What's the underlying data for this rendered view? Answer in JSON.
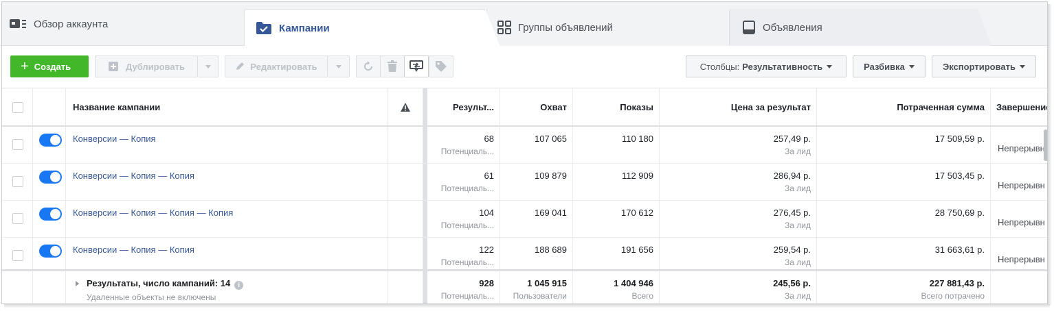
{
  "tabs": {
    "overview": "Обзор аккаунта",
    "campaigns": "Кампании",
    "adsets": "Группы объявлений",
    "ads": "Объявления"
  },
  "toolbar": {
    "create": "Создать",
    "duplicate": "Дублировать",
    "edit": "Редактировать",
    "columns_prefix": "Столбцы:",
    "columns_value": "Результативность",
    "breakdown": "Разбивка",
    "export": "Экспортировать"
  },
  "table": {
    "headers": {
      "name": "Название кампании",
      "results": "Результ...",
      "reach": "Охват",
      "impressions": "Показы",
      "cost": "Цена за результат",
      "spent": "Потраченная сумма",
      "end": "Завершение"
    },
    "rows": [
      {
        "name": "Конверсии — Копия",
        "results": "68",
        "results_sub": "Потенциаль...",
        "reach": "107 065",
        "impressions": "110 180",
        "cost": "257,49 р.",
        "cost_sub": "За лид",
        "spent": "17 509,59 р.",
        "end": "Непрерывн"
      },
      {
        "name": "Конверсии — Копия — Копия",
        "results": "61",
        "results_sub": "Потенциаль...",
        "reach": "109 879",
        "impressions": "112 909",
        "cost": "286,94 р.",
        "cost_sub": "За лид",
        "spent": "17 503,45 р.",
        "end": "Непрерывн"
      },
      {
        "name": "Конверсии — Копия — Копия — Копия",
        "results": "104",
        "results_sub": "Потенциаль...",
        "reach": "169 041",
        "impressions": "170 612",
        "cost": "276,45 р.",
        "cost_sub": "За лид",
        "spent": "28 750,69 р.",
        "end": "Непрерывн"
      },
      {
        "name": "Конверсии — Копия — Копия",
        "results": "122",
        "results_sub": "Потенциаль...",
        "reach": "188 689",
        "impressions": "191 656",
        "cost": "259,54 р.",
        "cost_sub": "За лид",
        "spent": "31 663,61 р.",
        "end": "Непрерывн"
      }
    ],
    "total": {
      "label": "Результаты, число кампаний: 14",
      "sub": "Удаленные объекты не включены",
      "results": "928",
      "results_sub": "Потенциаль...",
      "reach": "1 045 915",
      "reach_sub": "Пользователи",
      "impressions": "1 404 946",
      "impressions_sub": "Всего",
      "cost": "245,56 р.",
      "cost_sub": "За лид",
      "spent": "227 881,43 р.",
      "spent_sub": "Всего потрачено"
    }
  },
  "colors": {
    "accent": "#365899",
    "create_green": "#42b72a",
    "toggle_blue": "#1877f2"
  }
}
